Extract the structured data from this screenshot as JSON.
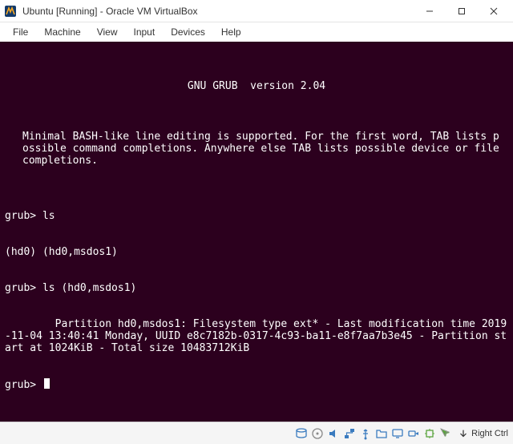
{
  "window": {
    "title": "Ubuntu [Running] - Oracle VM VirtualBox"
  },
  "menu": {
    "file": "File",
    "machine": "Machine",
    "view": "View",
    "input": "Input",
    "devices": "Devices",
    "help": "Help"
  },
  "console": {
    "header": "GNU GRUB  version 2.04",
    "help": "Minimal BASH-like line editing is supported. For the first word, TAB lists possible command completions. Anywhere else TAB lists possible device or file completions.",
    "lines": {
      "l0": "grub> ls",
      "l1": "(hd0) (hd0,msdos1)",
      "l2": "grub> ls (hd0,msdos1)",
      "l3": "        Partition hd0,msdos1: Filesystem type ext* - Last modification time 2019-11-04 13:40:41 Monday, UUID e8c7182b-0317-4c93-ba11-e8f7aa7b3e45 - Partition start at 1024KiB - Total size 10483712KiB",
      "l4": "grub> "
    }
  },
  "status": {
    "hostkey": "Right Ctrl"
  }
}
